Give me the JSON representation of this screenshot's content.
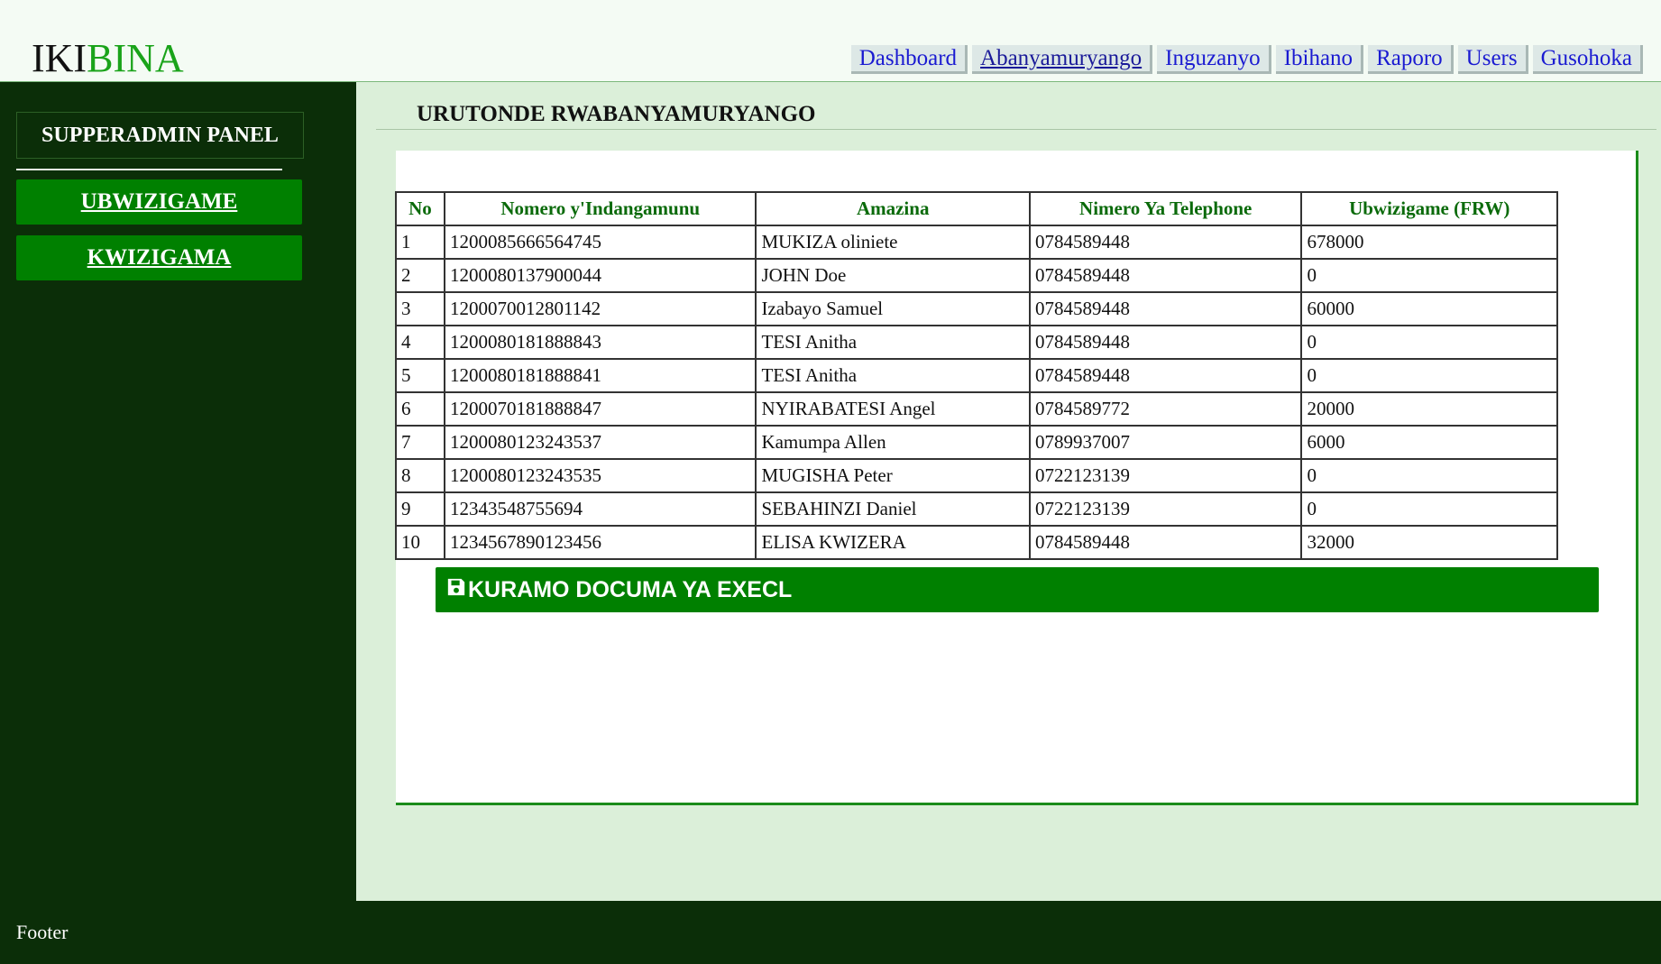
{
  "logo": {
    "part1": "IKI",
    "part2": "BINA"
  },
  "nav": {
    "items": [
      {
        "label": "Dashboard"
      },
      {
        "label": "Abanyamuryango"
      },
      {
        "label": "Inguzanyo"
      },
      {
        "label": "Ibihano"
      },
      {
        "label": "Raporo"
      },
      {
        "label": "Users"
      },
      {
        "label": "Gusohoka"
      }
    ],
    "active": "Abanyamuryango"
  },
  "sidebar": {
    "panel_title": "SUPPERADMIN PANEL",
    "buttons": [
      {
        "label": "UBWIZIGAME"
      },
      {
        "label": "KWIZIGAMA"
      }
    ]
  },
  "main": {
    "title": "URUTONDE RWABANYAMURYANGO",
    "table": {
      "headers": [
        "No",
        "Nomero y'Indangamunu",
        "Amazina",
        "Nimero Ya Telephone",
        "Ubwizigame (FRW)"
      ],
      "rows": [
        [
          "1",
          "1200085666564745",
          "MUKIZA oliniete",
          "0784589448",
          "678000"
        ],
        [
          "2",
          "1200080137900044",
          "JOHN Doe",
          "0784589448",
          "0"
        ],
        [
          "3",
          "1200070012801142",
          "Izabayo Samuel",
          "0784589448",
          "60000"
        ],
        [
          "4",
          "1200080181888843",
          "TESI Anitha",
          "0784589448",
          "0"
        ],
        [
          "5",
          "1200080181888841",
          "TESI Anitha",
          "0784589448",
          "0"
        ],
        [
          "6",
          "1200070181888847",
          "NYIRABATESI Angel",
          "0784589772",
          "20000"
        ],
        [
          "7",
          "1200080123243537",
          "Kamumpa Allen",
          "0789937007",
          "6000"
        ],
        [
          "8",
          "1200080123243535",
          "MUGISHA Peter",
          "0722123139",
          "0"
        ],
        [
          "9",
          "12343548755694",
          "SEBAHINZI Daniel",
          "0722123139",
          "0"
        ],
        [
          "10",
          "1234567890123456",
          "ELISA KWIZERA",
          "0784589448",
          "32000"
        ]
      ]
    },
    "export_button": "KURAMO DOCUMA YA EXECL",
    "export_icon": "save-icon"
  },
  "footer": {
    "text": "Footer"
  },
  "colors": {
    "sidebar_bg": "#0b2e08",
    "accent_green": "#008000",
    "main_bg": "#dbefd9",
    "nav_link": "#1a1ad1",
    "header_text": "#0a6a0a"
  }
}
